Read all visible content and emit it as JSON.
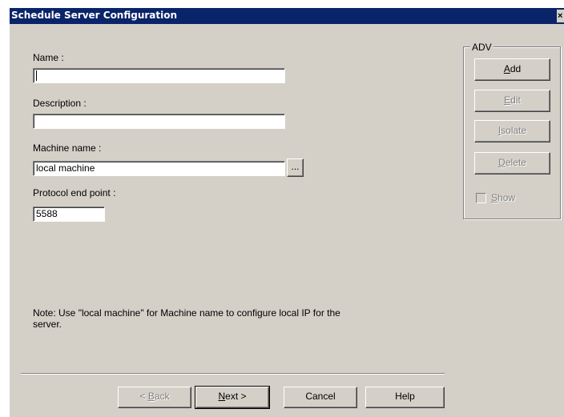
{
  "window": {
    "title": "Schedule Server Configuration",
    "close_label": "×"
  },
  "form": {
    "name_label": "Name :",
    "name_value": "",
    "description_label": "Description :",
    "description_value": "",
    "machine_name_label": "Machine name :",
    "machine_name_value": "local machine",
    "browse_label": "...",
    "protocol_label": "Protocol end point :",
    "protocol_value": "5588",
    "note": "Note: Use \"local machine\" for Machine name to configure local IP for the server."
  },
  "adv_group": {
    "title": "ADV",
    "buttons": [
      {
        "prefix": "",
        "mnemonic": "A",
        "rest": "dd",
        "enabled": true
      },
      {
        "prefix": "",
        "mnemonic": "E",
        "rest": "dit",
        "enabled": false
      },
      {
        "prefix": "",
        "mnemonic": "I",
        "rest": "solate",
        "enabled": false
      },
      {
        "prefix": "",
        "mnemonic": "D",
        "rest": "elete",
        "enabled": false
      }
    ],
    "show": {
      "prefix": "",
      "mnemonic": "S",
      "rest": "how",
      "checked": false,
      "enabled": false
    }
  },
  "footer": {
    "back": {
      "prefix": "< ",
      "mnemonic": "B",
      "rest": "ack",
      "enabled": false
    },
    "next": {
      "prefix": "",
      "mnemonic": "N",
      "rest": "ext >",
      "enabled": true
    },
    "cancel_label": "Cancel",
    "help_label": "Help"
  },
  "colors": {
    "titlebar": "#0a246a",
    "dialog_face": "#d4d0c8",
    "disabled_text": "#808080"
  }
}
